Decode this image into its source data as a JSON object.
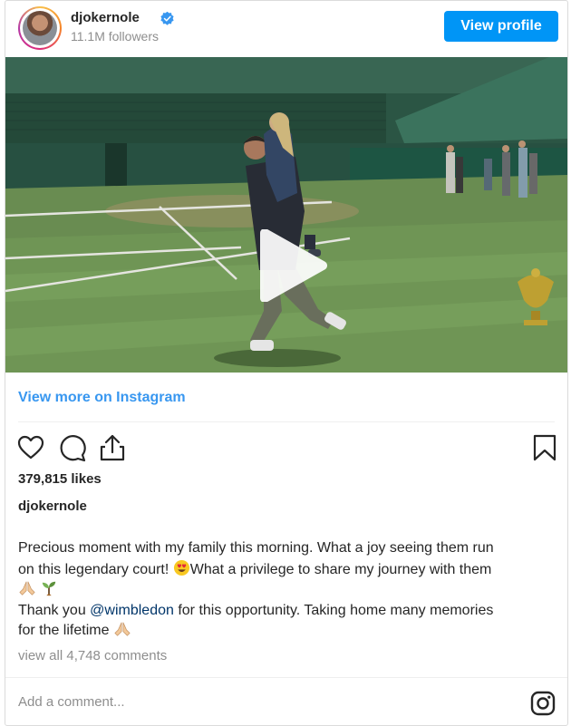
{
  "header": {
    "username": "djokernole",
    "followers": "11.1M followers",
    "view_profile_label": "View profile"
  },
  "media": {
    "type": "video",
    "play_icon": "play-icon"
  },
  "links": {
    "view_more": "View more on Instagram"
  },
  "actions": {
    "icons": [
      "heart-icon",
      "comment-icon",
      "share-icon",
      "bookmark-icon"
    ]
  },
  "post": {
    "likes": "379,815 likes",
    "caption_user": "djokernole",
    "caption_line1": "Precious moment with my family this morning. What a joy seeing them run",
    "caption_line2": "on this legendary court! ",
    "caption_line2b": "What a privilege to share my journey with them",
    "caption_line4_a": "Thank you ",
    "caption_mention": "@wimbledon",
    "caption_line4_b": " for this opportunity. Taking home many memories",
    "caption_line5": "for the lifetime ",
    "view_comments": "view all 4,748 comments"
  },
  "comment_box": {
    "placeholder": "Add a comment...",
    "brand_icon": "instagram-icon"
  },
  "colors": {
    "accent": "#0095f6",
    "link": "#3897f0",
    "muted": "#8e8e8e",
    "verified": "#3897f0"
  }
}
